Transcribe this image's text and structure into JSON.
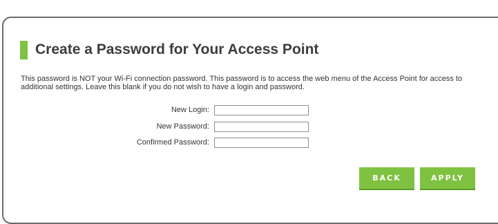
{
  "colors": {
    "accent": "#7fc241",
    "button": "#7fc241",
    "button_shadow": "#5a9a2a",
    "panel_border": "#6b6b6b",
    "heading_text": "#3d3d3d"
  },
  "page": {
    "title": "Create a Password for Your Access Point",
    "description": "This password is NOT your Wi-Fi connection password. This password is to access the web menu of the Access Point for access to additional settings. Leave this blank if you do not wish to have a login and password."
  },
  "form": {
    "new_login": {
      "label": "New Login:",
      "value": ""
    },
    "new_password": {
      "label": "New Password:",
      "value": ""
    },
    "confirmed_password": {
      "label": "Confirmed Password:",
      "value": ""
    }
  },
  "buttons": {
    "back_label": "BACK",
    "apply_label": "APPLY"
  }
}
